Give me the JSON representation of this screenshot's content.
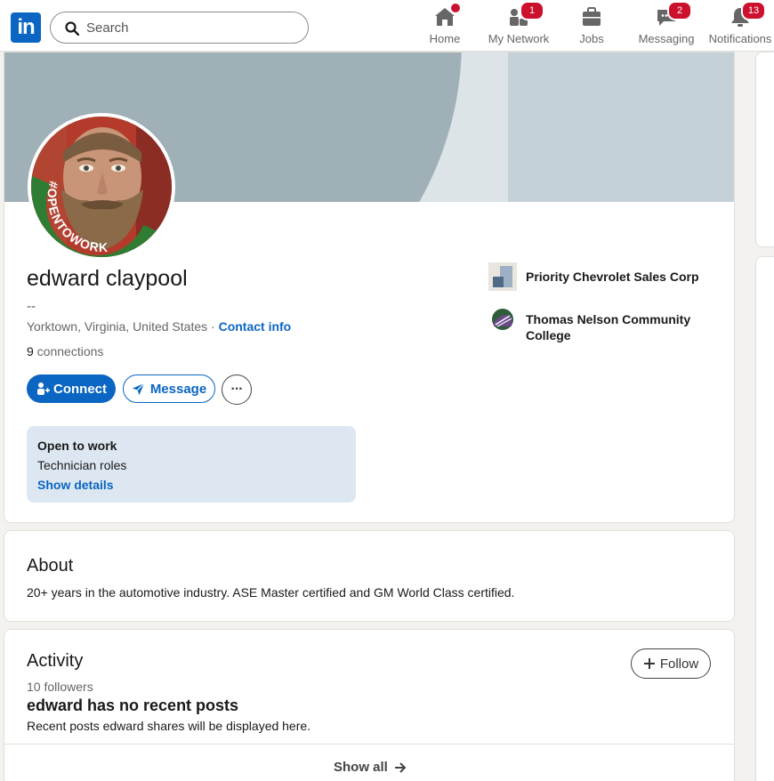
{
  "nav": {
    "logo_text": "in",
    "search_placeholder": "Search",
    "items": [
      {
        "label": "Home",
        "icon": "home-icon",
        "badge": ""
      },
      {
        "label": "My Network",
        "icon": "network-icon",
        "badge": "1"
      },
      {
        "label": "Jobs",
        "icon": "briefcase-icon",
        "badge": ""
      },
      {
        "label": "Messaging",
        "icon": "messaging-icon",
        "badge": "2"
      },
      {
        "label": "Notifications",
        "icon": "bell-icon",
        "badge": "13"
      }
    ]
  },
  "profile": {
    "name": "edward claypool",
    "headline": "--",
    "location": "Yorktown, Virginia, United States",
    "location_sep": " · ",
    "contact_info": "Contact info",
    "connections_count": "9",
    "connections_label": " connections",
    "open_to_work_frame": "#OPENTOWORK",
    "connect_label": "Connect",
    "message_label": "Message",
    "more_label": "···",
    "open_to_work": {
      "title": "Open to work",
      "roles": "Technician roles",
      "link": "Show details"
    },
    "experience": [
      {
        "label": "Priority Chevrolet Sales Corp",
        "icon": "company-logo-icon"
      },
      {
        "label": "Thomas Nelson Community College",
        "icon": "college-logo-icon"
      }
    ]
  },
  "about": {
    "title": "About",
    "text": "20+ years in the automotive industry.  ASE Master certified and GM World Class certified."
  },
  "activity": {
    "title": "Activity",
    "followers": "10 followers",
    "follow_label": "Follow",
    "no_posts": "edward has no recent posts",
    "no_posts_sub": "Recent posts edward shares will be displayed here.",
    "show_all": "Show all"
  },
  "colors": {
    "brand": "#0a66c2",
    "badge": "#cb112d",
    "open_to_work_ring": "#2e7d32",
    "open_to_work_box": "#dde7f1"
  }
}
